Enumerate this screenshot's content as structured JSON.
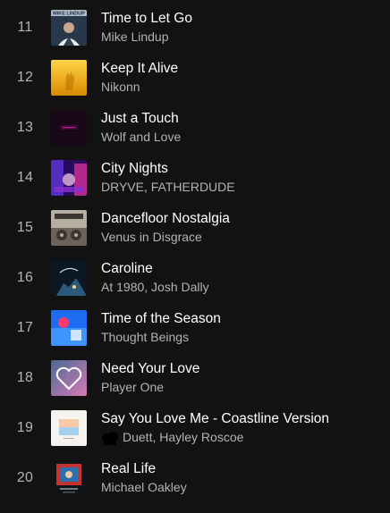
{
  "tracks": [
    {
      "number": "11",
      "title": "Time to Let Go",
      "artist": "Mike Lindup",
      "cover_label": "MIKE LINDUP",
      "colors": [
        "#1a2a3c",
        "#c8d4de",
        "#3a4e62"
      ]
    },
    {
      "number": "12",
      "title": "Keep It Alive",
      "artist": "Nikonn",
      "colors": [
        "#f0a400",
        "#ffd54a",
        "#b87000"
      ]
    },
    {
      "number": "13",
      "title": "Just a Touch",
      "artist": "Wolf and Love",
      "colors": [
        "#1a0718",
        "#3a0d34",
        "#c21b9a"
      ]
    },
    {
      "number": "14",
      "title": "City Nights",
      "artist": "DRYVE, FATHERDUDE",
      "colors": [
        "#2a0a5e",
        "#e0339e",
        "#5f36d6"
      ]
    },
    {
      "number": "15",
      "title": "Dancefloor Nostalgia",
      "artist": "Venus in Disgrace",
      "colors": [
        "#3c3633",
        "#b5aea3",
        "#6d625a"
      ]
    },
    {
      "number": "16",
      "title": "Caroline",
      "artist": "At 1980, Josh Dally",
      "colors": [
        "#0c1724",
        "#2b5a7a",
        "#d1e4f0"
      ]
    },
    {
      "number": "17",
      "title": "Time of the Season",
      "artist": "Thought Beings",
      "colors": [
        "#1d6df2",
        "#3f95ff",
        "#ff3a6f"
      ]
    },
    {
      "number": "18",
      "title": "Need Your Love",
      "artist": "Player One",
      "colors": [
        "#4a6a96",
        "#d77ab5",
        "#ffffff"
      ]
    },
    {
      "number": "19",
      "title": "Say You Love Me - Coastline Version",
      "artist": "Duett, Hayley Roscoe",
      "colors": [
        "#f7f4ef",
        "#f7c9a6",
        "#a5d0ef"
      ]
    },
    {
      "number": "20",
      "title": "Real Life",
      "artist": "Michael Oakley",
      "colors": [
        "#101418",
        "#c2342d",
        "#2a6fb0"
      ]
    }
  ]
}
